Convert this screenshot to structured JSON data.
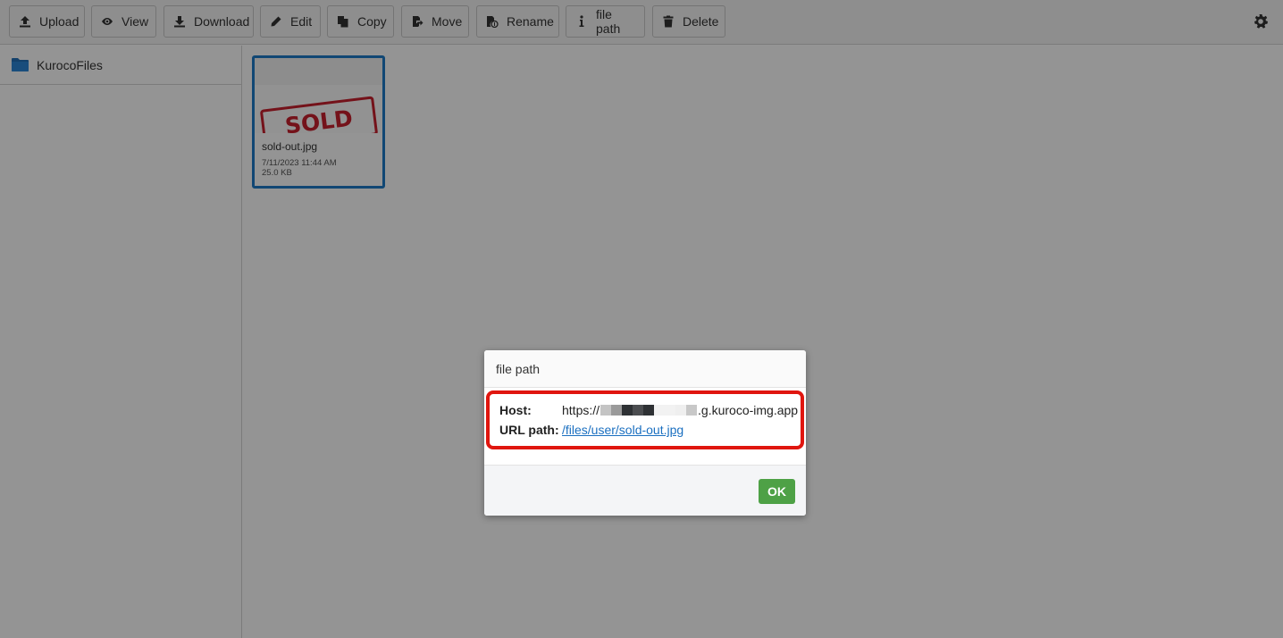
{
  "toolbar": {
    "buttons": [
      {
        "label": "Upload",
        "icon": "upload-icon"
      },
      {
        "label": "View",
        "icon": "eye-icon"
      },
      {
        "label": "Download",
        "icon": "download-icon"
      },
      {
        "label": "Edit",
        "icon": "pencil-icon"
      },
      {
        "label": "Copy",
        "icon": "copy-icon"
      },
      {
        "label": "Move",
        "icon": "move-icon"
      },
      {
        "label": "Rename",
        "icon": "rename-icon"
      },
      {
        "label": "file path",
        "icon": "info-icon"
      },
      {
        "label": "Delete",
        "icon": "trash-icon"
      }
    ],
    "settings_icon": "gear-icon"
  },
  "sidebar": {
    "items": [
      {
        "label": "KurocoFiles",
        "icon": "folder-icon"
      }
    ]
  },
  "files": [
    {
      "name": "sold-out.jpg",
      "thumbnail_text": "SOLD OUT",
      "date": "7/11/2023 11:44 AM",
      "size": "25.0 KB",
      "selected": true
    }
  ],
  "dialog": {
    "title": "file path",
    "host_label": "Host:",
    "host_prefix": "https://",
    "host_redacted_shades": [
      "#c4c4c4",
      "#9a9a9a",
      "#2e3134",
      "#4b4d50",
      "#2e3134",
      "#f2f2f2",
      "#f2f2f2",
      "#efefef",
      "#c8c8c8"
    ],
    "host_suffix": ".g.kuroco-img.app",
    "url_path_label": "URL path:",
    "url_path": "/files/user/sold-out.jpg",
    "ok_label": "OK",
    "highlight_color": "#e0160f",
    "ok_color": "#4ea146"
  }
}
